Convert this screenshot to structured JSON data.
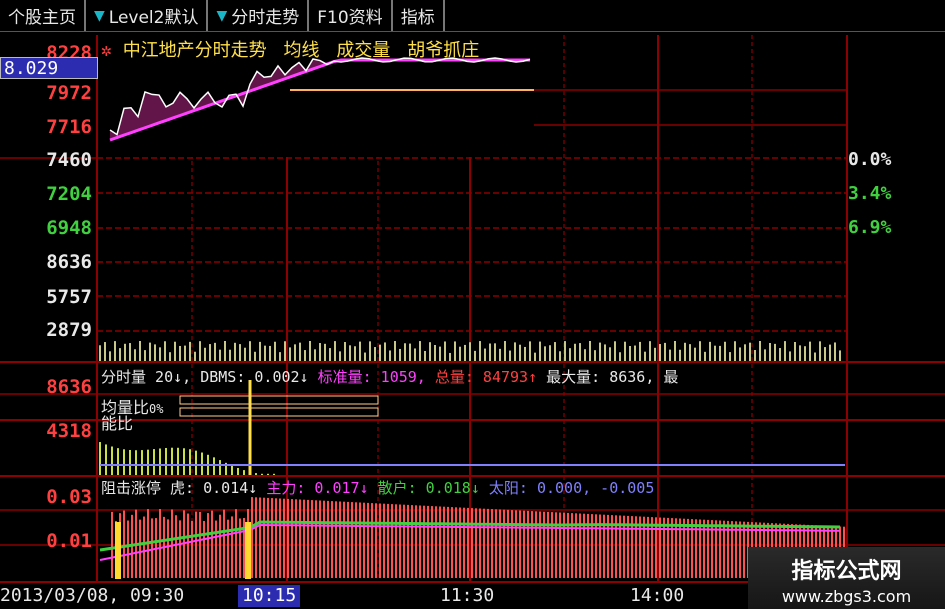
{
  "tabs": [
    {
      "label": "个股主页",
      "arrow": false
    },
    {
      "label": "Level2默认",
      "arrow": true
    },
    {
      "label": "分时走势",
      "arrow": true
    },
    {
      "label": "F10资料",
      "arrow": false
    },
    {
      "label": "指标",
      "arrow": false
    }
  ],
  "price_chart": {
    "legend_marker": "✲",
    "title": "中江地产分时走势",
    "legend": [
      "均线",
      "成交量",
      "胡爷抓庄"
    ],
    "cursor_price": "8.029",
    "y_labels": [
      "8228",
      "7972",
      "7716",
      "7460",
      "7204",
      "6948"
    ],
    "pct_labels": [
      "0.0%",
      "3.4%",
      "6.9%"
    ]
  },
  "volume_axis": [
    "8636",
    "5757",
    "2879"
  ],
  "volume_panel": {
    "y_labels": [
      "8636",
      "4318"
    ],
    "indicator": {
      "name": "分时量",
      "period": "20",
      "items": [
        {
          "label": "DBMS:",
          "value": "0.002",
          "arrow": "↓"
        },
        {
          "label": "标准量:",
          "value": "1059,",
          "arrow": ""
        },
        {
          "label": "总量:",
          "value": "84793",
          "arrow": "↑"
        },
        {
          "label": "最大量:",
          "value": "8636,",
          "arrow": ""
        },
        {
          "label": "最",
          "value": "",
          "arrow": ""
        }
      ]
    },
    "overlay_1": "均量比",
    "overlay_1_value": "0%",
    "overlay_2": "能比"
  },
  "bottom_panel": {
    "y_labels": [
      "0.03",
      "0.01"
    ],
    "indicator": {
      "name": "阻击涨停",
      "items": [
        {
          "label": "虎:",
          "value": "0.014",
          "arrow": "↓"
        },
        {
          "label": "主力:",
          "value": "0.017",
          "arrow": "↓"
        },
        {
          "label": "散户:",
          "value": "0.018",
          "arrow": "↓"
        },
        {
          "label": "太阳:",
          "value": "0.000,",
          "arrow": ""
        },
        {
          "label": "",
          "value": "-0.005",
          "arrow": ""
        }
      ]
    }
  },
  "x_axis": {
    "date_time": "2013/03/08, 09:30",
    "cursor_time": "10:15",
    "ticks": [
      "11:30",
      "14:00"
    ]
  },
  "watermark": {
    "line1": "指标公式网",
    "line2": "www.zbgs3.com"
  },
  "colors": {
    "grid": "#8b0000",
    "price_line": "#ffffff",
    "avg_line": "#ffe04a",
    "indicator_magenta": "#ff40ff",
    "up": "#ff4040",
    "down": "#40d040",
    "tab_arrow": "#19b6c8"
  }
}
